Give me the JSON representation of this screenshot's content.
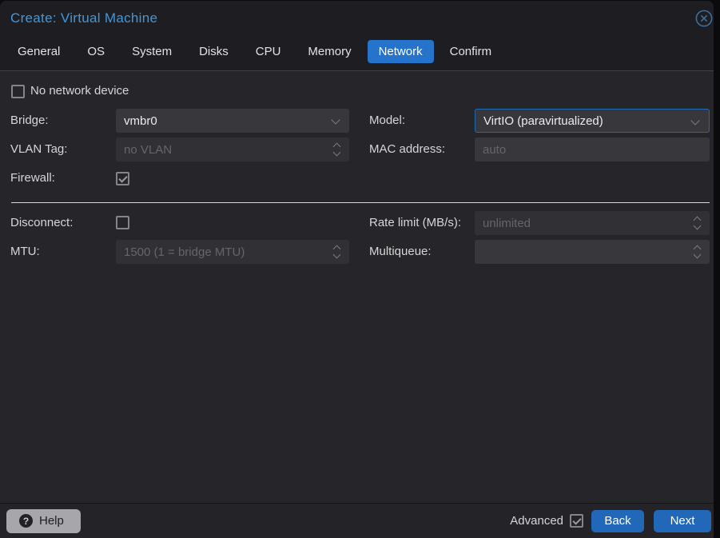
{
  "dialog": {
    "title": "Create: Virtual Machine"
  },
  "tabs": [
    {
      "label": "General",
      "active": false
    },
    {
      "label": "OS",
      "active": false
    },
    {
      "label": "System",
      "active": false
    },
    {
      "label": "Disks",
      "active": false
    },
    {
      "label": "CPU",
      "active": false
    },
    {
      "label": "Memory",
      "active": false
    },
    {
      "label": "Network",
      "active": true
    },
    {
      "label": "Confirm",
      "active": false
    }
  ],
  "form": {
    "no_network_device": {
      "label": "No network device",
      "checked": false
    },
    "bridge": {
      "label": "Bridge:",
      "value": "vmbr0"
    },
    "vlan_tag": {
      "label": "VLAN Tag:",
      "placeholder": "no VLAN",
      "disabled": true
    },
    "firewall": {
      "label": "Firewall:",
      "checked": true
    },
    "model": {
      "label": "Model:",
      "value": "VirtIO (paravirtualized)",
      "focused": true
    },
    "mac_address": {
      "label": "MAC address:",
      "placeholder": "auto"
    },
    "disconnect": {
      "label": "Disconnect:",
      "checked": false
    },
    "mtu": {
      "label": "MTU:",
      "placeholder": "1500 (1 = bridge MTU)",
      "disabled": true
    },
    "rate_limit": {
      "label": "Rate limit (MB/s):",
      "placeholder": "unlimited",
      "disabled": true
    },
    "multiqueue": {
      "label": "Multiqueue:",
      "placeholder": ""
    }
  },
  "footer": {
    "help_label": "Help",
    "advanced_label": "Advanced",
    "advanced_checked": true,
    "back_label": "Back",
    "next_label": "Next"
  },
  "colors": {
    "title_blue": "#3f97dd",
    "tab_active_bg": "#2673cc",
    "button_blue": "#2268b8",
    "focus_border": "#2168b4"
  }
}
